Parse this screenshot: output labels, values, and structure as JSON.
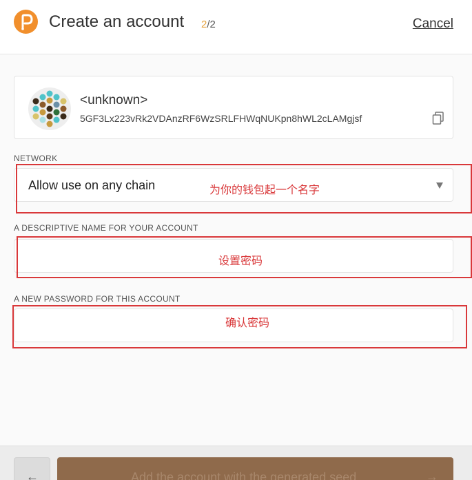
{
  "header": {
    "title": "Create an account",
    "step_current": "2",
    "step_total": "/2",
    "cancel_label": "Cancel",
    "logo_icon": "polkadot-logo-icon"
  },
  "account": {
    "name": "<unknown>",
    "address": "5GF3Lx223vRk2VDAnzRF6WzSRLFHWqNUKpn8hWL2cLAMgjsf",
    "identicon_icon": "identicon",
    "copy_icon": "copy-icon"
  },
  "network": {
    "label": "NETWORK",
    "selected": "Allow use on any chain"
  },
  "name_field": {
    "label": "A DESCRIPTIVE NAME FOR YOUR ACCOUNT",
    "value": ""
  },
  "password_field": {
    "label": "A NEW PASSWORD FOR THIS ACCOUNT",
    "value": ""
  },
  "annotations": {
    "note1": "为你的钱包起一个名字",
    "note2": "设置密码",
    "note3": "确认密码",
    "color": "#d9383a"
  },
  "footer": {
    "back_icon": "arrow-left-icon",
    "back_glyph": "←",
    "next_label": "Add the account with the generated seed",
    "next_glyph": "→"
  },
  "colors": {
    "brand": "#f18f2c",
    "step_accent": "#e6a23c",
    "next_button": "#8f6a4b"
  }
}
